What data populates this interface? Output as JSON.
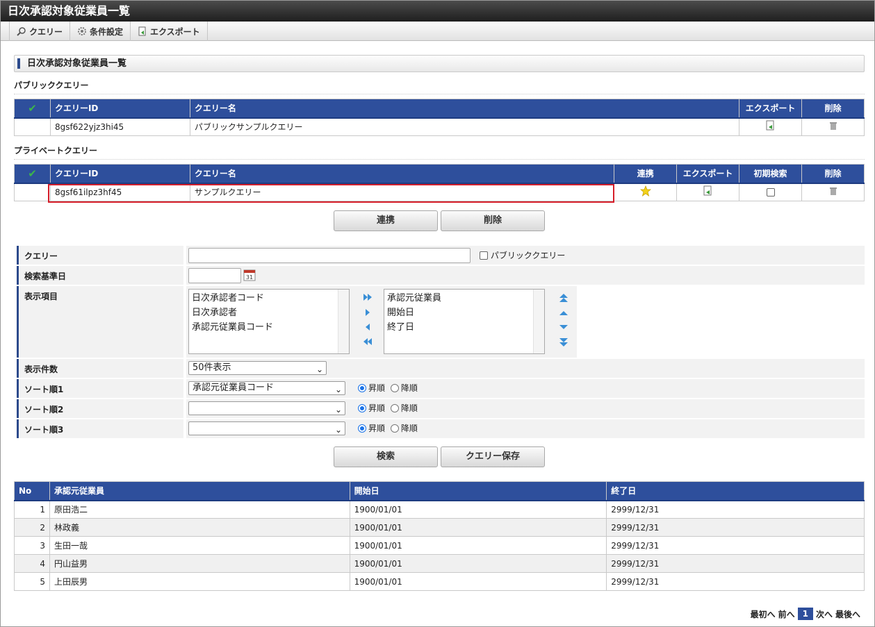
{
  "window": {
    "title": "日次承認対象従業員一覧"
  },
  "toolbar": {
    "query": "クエリー",
    "conditions": "条件設定",
    "export": "エクスポート"
  },
  "section_title": "日次承認対象従業員一覧",
  "public_query": {
    "heading": "パブリッククエリー",
    "columns": [
      "クエリーID",
      "クエリー名",
      "エクスポート",
      "削除"
    ],
    "rows": [
      {
        "id": "8gsf622yjz3hi45",
        "name": "パブリックサンプルクエリー"
      }
    ]
  },
  "private_query": {
    "heading": "プライベートクエリー",
    "columns": [
      "クエリーID",
      "クエリー名",
      "連携",
      "エクスポート",
      "初期検索",
      "削除"
    ],
    "rows": [
      {
        "id": "8gsf61ilpz3hf45",
        "name": "サンプルクエリー"
      }
    ]
  },
  "buttons": {
    "link": "連携",
    "delete": "削除",
    "search": "検索",
    "save_query": "クエリー保存"
  },
  "form": {
    "query_label": "クエリー",
    "query_value": "",
    "public_checkbox_label": "パブリッククエリー",
    "base_date_label": "検索基準日",
    "base_date_value": "",
    "display_items_label": "表示項目",
    "available_items": [
      "日次承認者コード",
      "日次承認者",
      "承認元従業員コード"
    ],
    "selected_items": [
      "承認元従業員",
      "開始日",
      "終了日"
    ],
    "count_label": "表示件数",
    "count_value": "50件表示",
    "sort1_label": "ソート順1",
    "sort1_value": "承認元従業員コード",
    "sort2_label": "ソート順2",
    "sort2_value": "",
    "sort3_label": "ソート順3",
    "sort3_value": "",
    "asc": "昇順",
    "desc": "降順"
  },
  "results": {
    "columns": [
      "No",
      "承認元従業員",
      "開始日",
      "終了日"
    ],
    "rows": [
      {
        "no": "1",
        "name": "原田浩二",
        "start": "1900/01/01",
        "end": "2999/12/31"
      },
      {
        "no": "2",
        "name": "林政義",
        "start": "1900/01/01",
        "end": "2999/12/31"
      },
      {
        "no": "3",
        "name": "生田一哉",
        "start": "1900/01/01",
        "end": "2999/12/31"
      },
      {
        "no": "4",
        "name": "円山益男",
        "start": "1900/01/01",
        "end": "2999/12/31"
      },
      {
        "no": "5",
        "name": "上田辰男",
        "start": "1900/01/01",
        "end": "2999/12/31"
      }
    ]
  },
  "pager": {
    "first": "最初へ",
    "prev": "前へ",
    "current": "1",
    "next": "次へ",
    "last": "最後へ"
  },
  "colors": {
    "header_blue": "#2e4f9c",
    "highlight_red": "#d61e2a",
    "check_green": "#3cb64a"
  }
}
